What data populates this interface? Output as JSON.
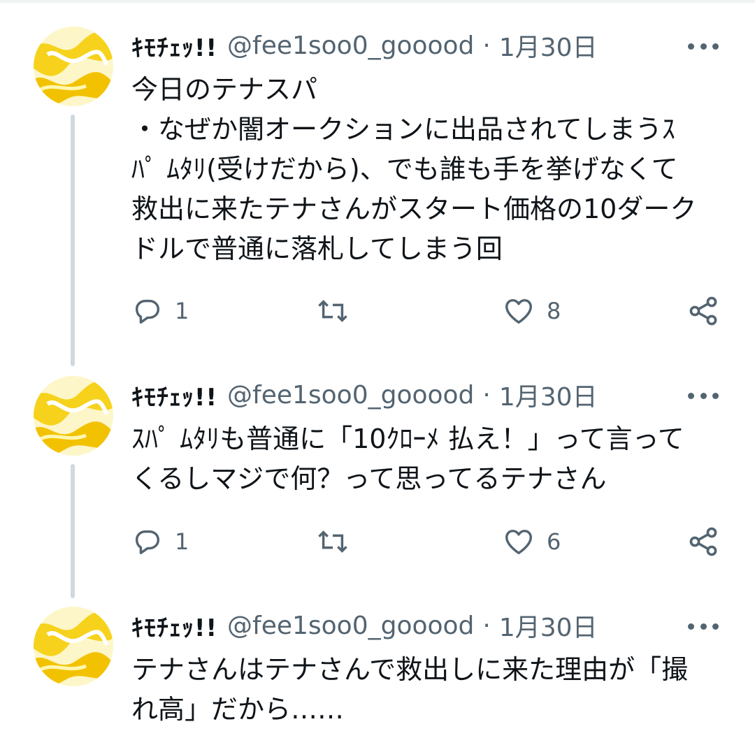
{
  "tweets": [
    {
      "display_name": "ｷﾓﾁｪｯ!!",
      "handle": "@fee1soo0_gooood",
      "separator": "·",
      "date": "1月30日",
      "text": "今日のテナスパ\n・なぜか闇オークションに出品されてしまうｽ\nﾊﾟ ﾑﾀﾘ(受けだから)、でも誰も手を挙げなくて\n救出に来たテナさんがスタート価格の10ダーク\nドルで普通に落札してしまう回",
      "reply_count": "1",
      "retweet_count": "",
      "like_count": "8"
    },
    {
      "display_name": "ｷﾓﾁｪｯ!!",
      "handle": "@fee1soo0_gooood",
      "separator": "·",
      "date": "1月30日",
      "text": "ｽﾊﾟ ﾑﾀﾘも普通に「10ｸﾛｰﾒ 払え！」って言って\nくるしマジで何？って思ってるテナさん",
      "reply_count": "1",
      "retweet_count": "",
      "like_count": "6"
    },
    {
      "display_name": "ｷﾓﾁｪｯ!!",
      "handle": "@fee1soo0_gooood",
      "separator": "·",
      "date": "1月30日",
      "text": "テナさんはテナさんで救出しに来た理由が「撮\nれ高」だから……"
    }
  ],
  "icons": {
    "more": "more-icon",
    "reply": "reply-icon",
    "retweet": "retweet-icon",
    "like": "like-icon",
    "share": "share-icon"
  },
  "colors": {
    "text": "#0f1419",
    "secondary": "#536471",
    "thread_line": "#cfd9de",
    "avatar_yellow": "#f6d21c"
  }
}
